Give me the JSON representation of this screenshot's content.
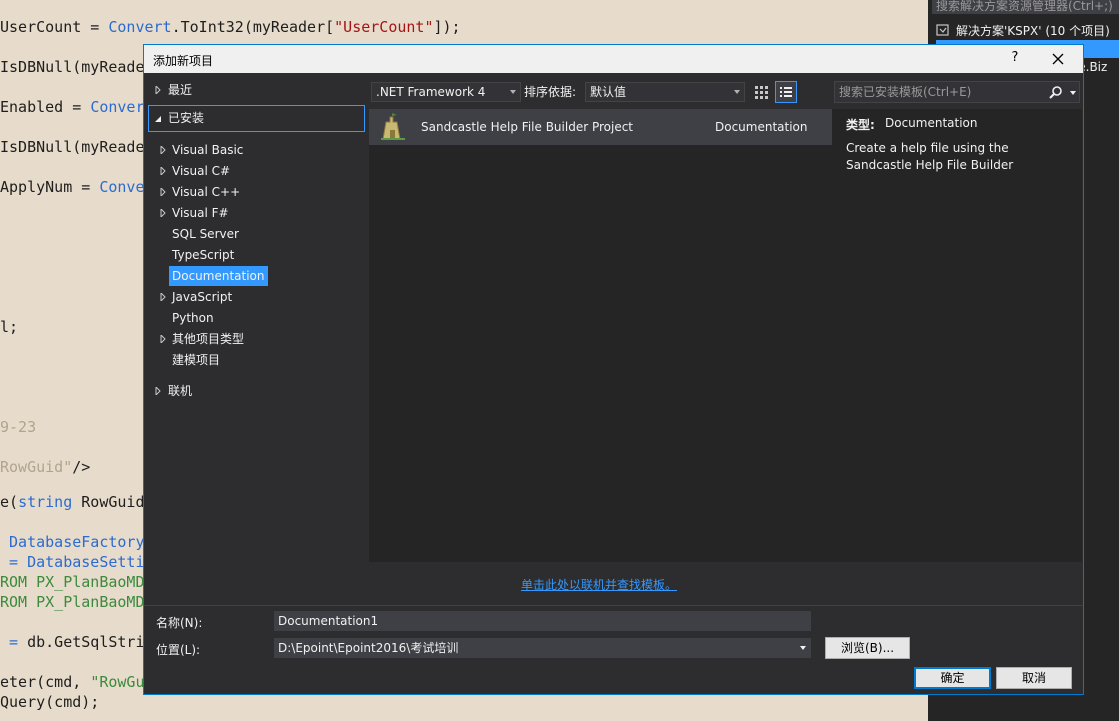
{
  "editor": {
    "lines": [
      {
        "parts": [
          [
            "",
            "UserCount = "
          ],
          [
            "kw",
            "Convert"
          ],
          [
            "",
            ".ToInt32(myReader["
          ],
          [
            "str",
            "\"UserCount\""
          ],
          [
            "",
            "]);"
          ]
        ]
      },
      {
        "parts": [
          [
            "",
            "IsDBNull(myReader"
          ]
        ]
      },
      {
        "parts": [
          [
            "",
            "Enabled = "
          ],
          [
            "kw",
            "Convert"
          ]
        ]
      },
      {
        "parts": [
          [
            "",
            "IsDBNull(myReader"
          ]
        ]
      },
      {
        "parts": [
          [
            "",
            "ApplyNum = "
          ],
          [
            "kw",
            "Conver"
          ]
        ]
      },
      {
        "parts": [
          [
            "",
            "l;"
          ]
        ]
      },
      {
        "parts": [
          [
            "gray",
            "9-23"
          ]
        ]
      },
      {
        "parts": [
          [
            "gray",
            "RowGuid\""
          ],
          [
            "",
            "/>"
          ]
        ]
      },
      {
        "parts": [
          [
            "",
            "e("
          ],
          [
            "kw",
            "string"
          ],
          [
            "",
            " RowGuid)"
          ]
        ]
      },
      {
        "parts": [
          [
            "kw",
            " DatabaseFactory."
          ]
        ]
      },
      {
        "parts": [
          [
            "kw",
            " = DatabaseSettin"
          ]
        ]
      },
      {
        "parts": [
          [
            "green",
            "ROM PX_PlanBaoMD"
          ]
        ]
      },
      {
        "parts": [
          [
            "green",
            "ROM PX_PlanBaoMD"
          ]
        ]
      },
      {
        "parts": [
          [
            "",
            ""
          ],
          [
            "kw",
            " = "
          ],
          [
            "",
            "db.GetSqlStrin"
          ]
        ]
      },
      {
        "parts": [
          [
            "",
            "eter(cmd, "
          ],
          [
            "green",
            "\"RowGui"
          ]
        ]
      },
      {
        "parts": [
          [
            "",
            "Query(cmd);"
          ]
        ]
      }
    ]
  },
  "solution_explorer": {
    "search_placeholder": "搜索解决方案资源管理器(Ctrl+;)",
    "root_label": "解决方案'KSPX' (10 个项目)",
    "partial_item": "se.Biz"
  },
  "dialog": {
    "title": "添加新项目",
    "help_label": "?",
    "tree": {
      "recent": "最近",
      "installed": "已安装",
      "items": [
        "Visual Basic",
        "Visual C#",
        "Visual C++",
        "Visual F#",
        "SQL Server",
        "TypeScript",
        "Documentation",
        "JavaScript",
        "Python",
        "其他项目类型",
        "建模项目"
      ],
      "online": "联机"
    },
    "toolbar": {
      "framework": ".NET Framework 4",
      "sort_label": "排序依据:",
      "sort_value": "默认值",
      "search_placeholder": "搜索已安装模板(Ctrl+E)"
    },
    "template": {
      "name": "Sandcastle Help File Builder Project",
      "category": "Documentation"
    },
    "description": {
      "type_label": "类型:",
      "type_value": "Documentation",
      "text": "Create a help file using the Sandcastle Help File Builder"
    },
    "online_link": "单击此处以联机并查找模板。",
    "form": {
      "name_label": "名称(N):",
      "name_value": "Documentation1",
      "location_label": "位置(L):",
      "location_value": "D:\\Epoint\\Epoint2016\\考试培训",
      "browse_label": "浏览(B)...",
      "ok_label": "确定",
      "cancel_label": "取消"
    }
  },
  "colors": {
    "accent": "#007acc",
    "selection": "#3399ff",
    "dialog_bg": "#2d2d30",
    "panel_bg": "#252526"
  }
}
